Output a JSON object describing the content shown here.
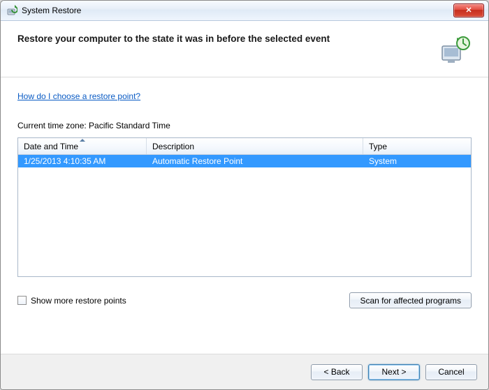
{
  "window": {
    "title": "System Restore"
  },
  "header": {
    "instruction": "Restore your computer to the state it was in before the selected event"
  },
  "help_link": "How do I choose a restore point?",
  "timezone_label": "Current time zone: Pacific Standard Time",
  "columns": {
    "date": "Date and Time",
    "description": "Description",
    "type": "Type"
  },
  "rows": [
    {
      "date": "1/25/2013 4:10:35 AM",
      "description": "Automatic Restore Point",
      "type": "System"
    }
  ],
  "show_more_label": "Show more restore points",
  "scan_button": "Scan for affected programs",
  "buttons": {
    "back": "< Back",
    "next": "Next >",
    "cancel": "Cancel"
  }
}
